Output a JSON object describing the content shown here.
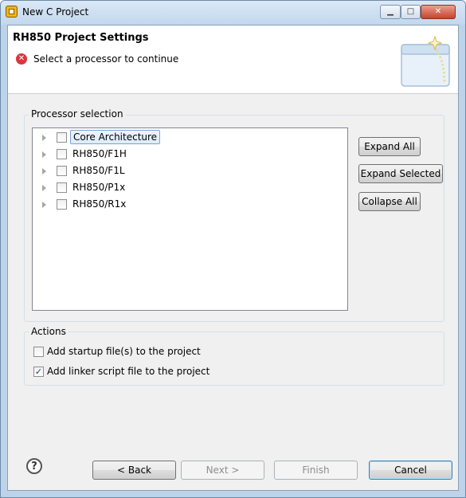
{
  "window": {
    "title": "New C Project",
    "buttons": {
      "minimize": "▁",
      "maximize": "□",
      "close": "✕"
    }
  },
  "header": {
    "title": "RH850 Project Settings",
    "message": "Select a processor to continue",
    "error_icon": "✕"
  },
  "processor_selection": {
    "legend": "Processor selection",
    "items": [
      {
        "label": "Core Architecture",
        "checked": false,
        "selected": true
      },
      {
        "label": "RH850/F1H",
        "checked": false,
        "selected": false
      },
      {
        "label": "RH850/F1L",
        "checked": false,
        "selected": false
      },
      {
        "label": "RH850/P1x",
        "checked": false,
        "selected": false
      },
      {
        "label": "RH850/R1x",
        "checked": false,
        "selected": false
      }
    ],
    "buttons": {
      "expand_all": "Expand All",
      "expand_selected": "Expand Selected",
      "collapse_all": "Collapse All"
    }
  },
  "actions": {
    "legend": "Actions",
    "items": [
      {
        "label": "Add startup file(s) to the project",
        "checked": false,
        "mark": ""
      },
      {
        "label": "Add linker script file to the project",
        "checked": true,
        "mark": "✓"
      }
    ]
  },
  "footer": {
    "help": "?",
    "back": "< Back",
    "next": "Next >",
    "finish": "Finish",
    "cancel": "Cancel"
  }
}
